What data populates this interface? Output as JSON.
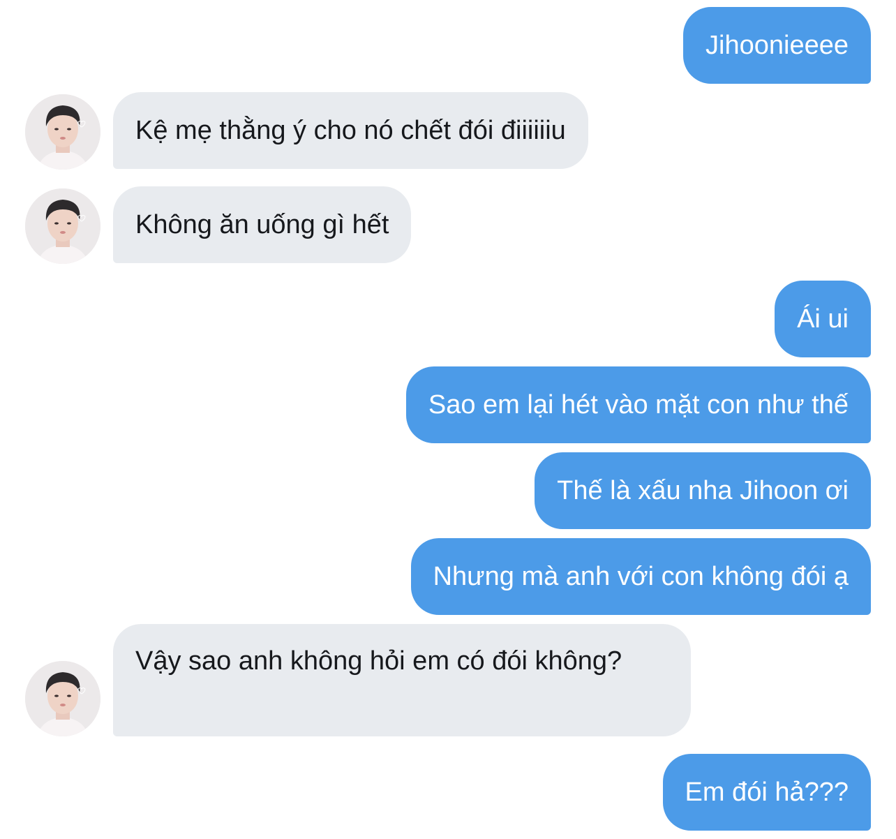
{
  "messages": [
    {
      "sender": "me",
      "text": "Jihoonieeee"
    },
    {
      "sender": "other",
      "text": "Kệ mẹ thằng ý cho nó chết đói điiiiiiu"
    },
    {
      "sender": "other",
      "text": "Không ăn uống gì hết"
    },
    {
      "sender": "me",
      "text": "Ái ui"
    },
    {
      "sender": "me",
      "text": "Sao em lại hét vào mặt con như thế"
    },
    {
      "sender": "me",
      "text": "Thế là xấu nha Jihoon ơi"
    },
    {
      "sender": "me",
      "text": "Nhưng mà anh với con không đói ạ"
    },
    {
      "sender": "other",
      "text": "Vậy sao anh không hỏi em có đói không?"
    },
    {
      "sender": "me",
      "text": "Em đói hả???"
    }
  ],
  "colors": {
    "outgoing_bubble": "#4c9be8",
    "incoming_bubble": "#e8ebef",
    "outgoing_text": "#ffffff",
    "incoming_text": "#16181c"
  },
  "avatar_icon": "user-avatar-photo"
}
